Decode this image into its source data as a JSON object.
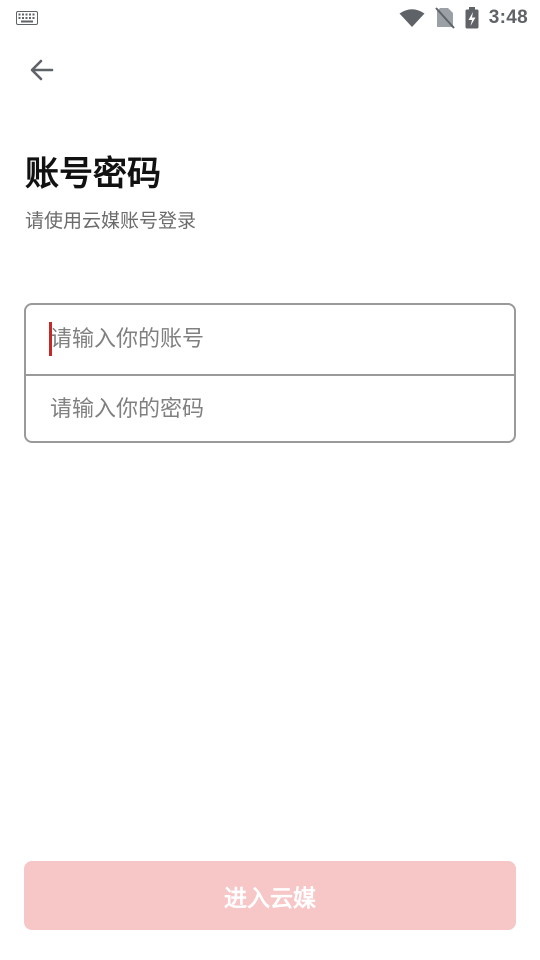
{
  "status_bar": {
    "time": "3:48",
    "icons": [
      "keyboard-icon",
      "wifi-icon",
      "no-sim-icon",
      "battery-charging-icon"
    ]
  },
  "header": {
    "back_icon": "arrow-left-icon",
    "title": "账号密码",
    "subtitle": "请使用云媒账号登录"
  },
  "form": {
    "account": {
      "value": "",
      "placeholder": "请输入你的账号"
    },
    "password": {
      "value": "",
      "placeholder": "请输入你的密码"
    }
  },
  "submit": {
    "label": "进入云媒"
  },
  "colors": {
    "accent_disabled": "#f7c6c7",
    "cursor": "#c62828",
    "border": "#9a9a9a",
    "status_icons": "#5f6368"
  }
}
